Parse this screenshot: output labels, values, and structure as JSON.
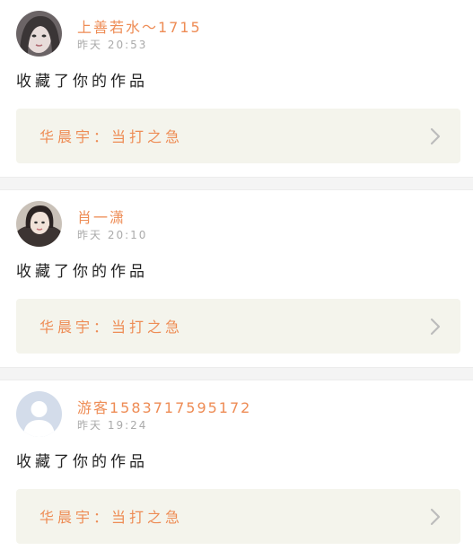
{
  "colors": {
    "accent": "#ee8c55",
    "muted": "#aaaaaa",
    "link_bg": "#f4f4ec",
    "chevron": "#bcbcbc"
  },
  "notifications": [
    {
      "user_name": "上善若水～1715",
      "timestamp": "昨天 20:53",
      "action": "收藏了你的作品",
      "work_title": "华晨宇：当打之急",
      "avatar_icon": "user-photo-dark-hair"
    },
    {
      "user_name": "肖一潇",
      "timestamp": "昨天 20:10",
      "action": "收藏了你的作品",
      "work_title": "华晨宇：当打之急",
      "avatar_icon": "user-photo-girl"
    },
    {
      "user_name": "游客15837175951​72",
      "timestamp": "昨天 19:24",
      "action": "收藏了你的作品",
      "work_title": "华晨宇：当打之急",
      "avatar_icon": "default-avatar-icon"
    }
  ]
}
